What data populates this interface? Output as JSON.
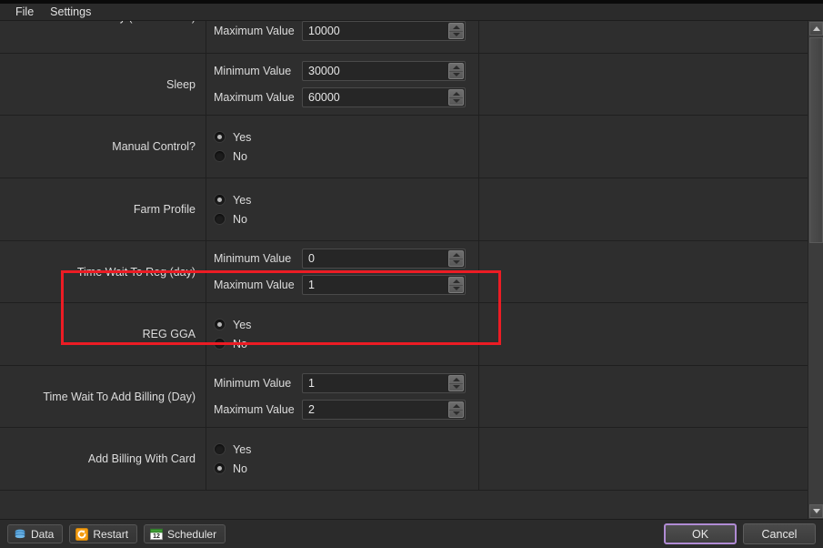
{
  "menubar": {
    "items": [
      {
        "label": "File",
        "name": "menu-file"
      },
      {
        "label": "Settings",
        "name": "menu-settings"
      }
    ]
  },
  "captions": {
    "minimum": "Minimum Value",
    "maximum": "Maximum Value",
    "yes": "Yes",
    "no": "No"
  },
  "rows": [
    {
      "id": "delay-milliseconds",
      "label": "Delay (Miliseconds)",
      "type": "range",
      "clipped_top": true,
      "minimum": "",
      "maximum": "10000",
      "show_minimum": false
    },
    {
      "id": "sleep",
      "label": "Sleep",
      "type": "range",
      "minimum": "30000",
      "maximum": "60000",
      "show_minimum": true
    },
    {
      "id": "manual-control",
      "label": "Manual Control?",
      "type": "yesno",
      "selected": "yes"
    },
    {
      "id": "farm-profile",
      "label": "Farm Profile",
      "type": "yesno",
      "selected": "yes"
    },
    {
      "id": "time-wait-to-reg-day",
      "label": "Time Wait To Reg (day)",
      "type": "range",
      "minimum": "0",
      "maximum": "1",
      "show_minimum": true,
      "highlighted": true
    },
    {
      "id": "reg-gga",
      "label": "REG GGA",
      "type": "yesno",
      "selected": "yes"
    },
    {
      "id": "time-wait-to-add-billing-day",
      "label": "Time Wait To Add Billing (Day)",
      "type": "range",
      "minimum": "1",
      "maximum": "2",
      "show_minimum": true
    },
    {
      "id": "add-billing-with-card",
      "label": "Add Billing With Card",
      "type": "yesno",
      "selected": "no"
    }
  ],
  "toolbar": {
    "buttons": [
      {
        "label": "Data",
        "icon": "database-icon",
        "name": "data-button"
      },
      {
        "label": "Restart",
        "icon": "restart-icon",
        "name": "restart-button"
      },
      {
        "label": "Scheduler",
        "icon": "calendar-icon",
        "name": "scheduler-button"
      }
    ],
    "ok_label": "OK",
    "cancel_label": "Cancel"
  },
  "scrollbar": {
    "up_arrow": "scroll-up-arrow",
    "down_arrow": "scroll-down-arrow"
  },
  "colors": {
    "background": "#2e2e2e",
    "highlight": "#ec1c24",
    "focus_border": "#b08bd4",
    "text": "#dcdcdc"
  }
}
